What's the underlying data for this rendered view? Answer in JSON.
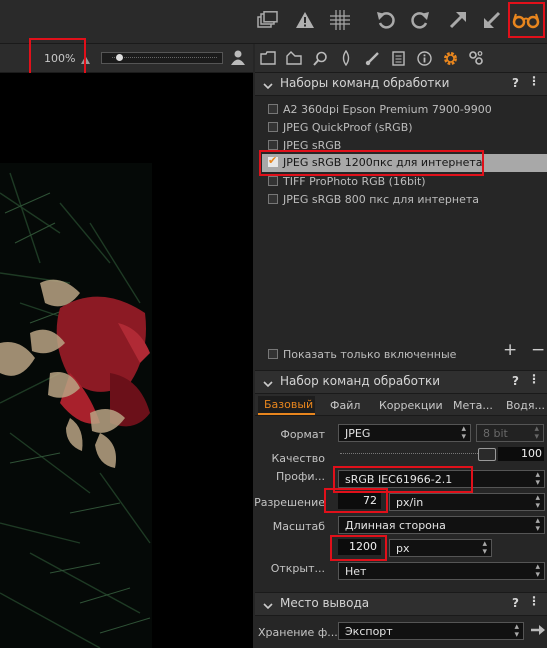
{
  "viewer": {
    "zoom": "100%"
  },
  "recipes_panel": {
    "title": "Наборы команд обработки",
    "help": "?",
    "items": [
      {
        "label": "A2 360dpi Epson Premium 7900-9900",
        "checked": false
      },
      {
        "label": "JPEG QuickProof (sRGB)",
        "checked": false
      },
      {
        "label": "JPEG sRGB",
        "checked": false
      },
      {
        "label": "JPEG sRGB 1200пкс для интернета",
        "checked": true
      },
      {
        "label": "TIFF ProPhoto RGB (16bit)",
        "checked": false
      },
      {
        "label": "JPEG sRGB 800 пкс для интернета",
        "checked": false
      }
    ],
    "show_enabled_only": "Показать только включенные",
    "add": "+",
    "remove": "−"
  },
  "recipe_panel": {
    "title": "Набор команд обработки",
    "help": "?",
    "tabs": [
      "Базовый",
      "Файл",
      "Коррекции",
      "Мета...",
      "Водя..."
    ],
    "format_label": "Формат",
    "format_value": "JPEG",
    "bit_value": "8 bit",
    "quality_label": "Качество",
    "quality_value": "100",
    "profile_label": "Профи...",
    "profile_value": "sRGB IEC61966-2.1",
    "resolution_label": "Разрешение",
    "resolution_value": "72",
    "resolution_unit": "px/in",
    "scale_label": "Масштаб",
    "scale_value": "Длинная сторона",
    "size_value": "1200",
    "size_unit": "px",
    "open_label": "Открыт...",
    "open_value": "Нет"
  },
  "output_panel": {
    "title": "Место вывода",
    "help": "?",
    "storage_label": "Хранение ф...",
    "storage_value": "Экспорт"
  },
  "colors": {
    "accent": "#e8861e",
    "highlight": "#e0101a",
    "selected_row": "#a8a8a8"
  }
}
